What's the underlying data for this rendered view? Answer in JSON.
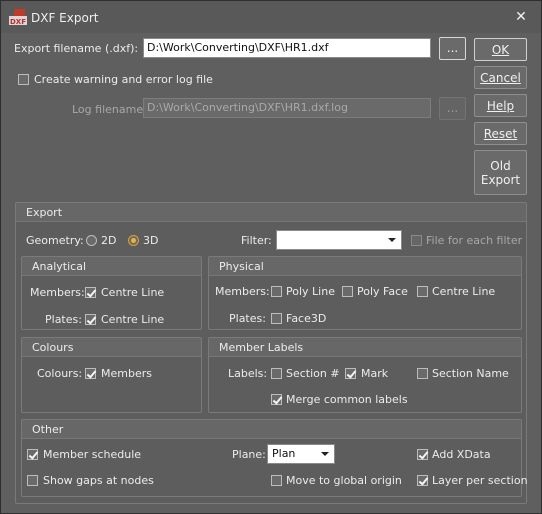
{
  "window": {
    "title": "DXF Export",
    "icon": "dxf-icon",
    "close_glyph": "✕"
  },
  "file": {
    "export_label": "Export filename (.dxf):",
    "export_value": "D:\\Work\\Converting\\DXF\\HR1.dxf",
    "browse_label": "...",
    "create_log_label": "Create warning and error log file",
    "create_log_checked": false,
    "log_label": "Log filename:",
    "log_value": "D:\\Work\\Converting\\DXF\\HR1.dxf.log",
    "log_browse_label": "..."
  },
  "buttons": {
    "ok": "OK",
    "cancel": "Cancel",
    "help": "Help",
    "reset": "Reset",
    "old_export_1": "Old",
    "old_export_2": "Export"
  },
  "export": {
    "title": "Export",
    "geometry_label": "Geometry:",
    "geometry_2d": "2D",
    "geometry_3d": "3D",
    "geometry_selected": "3D",
    "filter_label": "Filter:",
    "filter_value": "",
    "file_each_filter_label": "File for each filter",
    "file_each_filter_checked": false
  },
  "analytical": {
    "title": "Analytical",
    "members_label": "Members:",
    "members_centre_line": "Centre Line",
    "members_centre_line_checked": true,
    "plates_label": "Plates:",
    "plates_centre_line": "Centre Line",
    "plates_centre_line_checked": true
  },
  "physical": {
    "title": "Physical",
    "members_label": "Members:",
    "poly_line": "Poly Line",
    "poly_face": "Poly Face",
    "centre_line": "Centre Line",
    "plates_label": "Plates:",
    "face3d": "Face3D"
  },
  "colours": {
    "title": "Colours",
    "colours_label": "Colours:",
    "members": "Members",
    "members_checked": true
  },
  "member_labels": {
    "title": "Member Labels",
    "labels_label": "Labels:",
    "section": "Section #",
    "mark": "Mark",
    "mark_checked": true,
    "section_name": "Section Name",
    "merge": "Merge common labels",
    "merge_checked": true
  },
  "other": {
    "title": "Other",
    "member_schedule": "Member schedule",
    "member_schedule_checked": true,
    "show_gaps": "Show gaps at nodes",
    "plane_label": "Plane:",
    "plane_value": "Plan",
    "move_origin": "Move to global origin",
    "add_xdata": "Add XData",
    "add_xdata_checked": true,
    "layer_per_section": "Layer per section",
    "layer_per_section_checked": true
  },
  "colors": {
    "accent_radio": "#f0b040",
    "window_bg": "#5f5f5f"
  }
}
